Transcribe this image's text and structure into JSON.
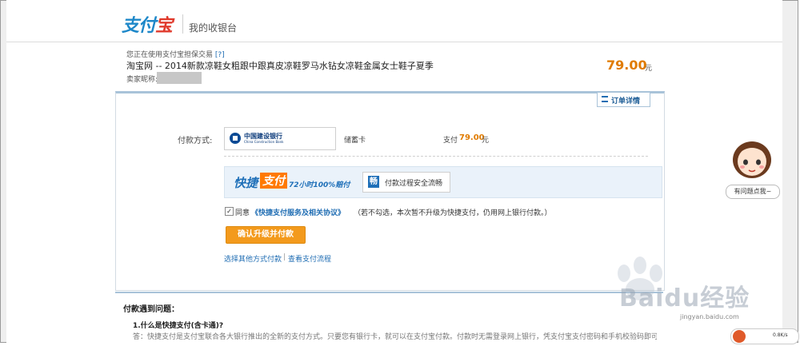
{
  "header": {
    "logo_text_blue": "支付",
    "logo_text_red": "宝",
    "cashier_title": "我的收银台"
  },
  "order": {
    "guarantee_text": "您正在使用支付宝担保交易",
    "guarantee_link": "[?]",
    "title": "淘宝网 -- 2014新款凉鞋女粗跟中跟真皮凉鞋罗马水钻女凉鞋金属女士鞋子夏季",
    "seller_label": "卖家昵称:",
    "price": "79.00",
    "price_unit": "元",
    "detail_button": "订单详情"
  },
  "payment": {
    "method_label": "付款方式:",
    "bank_name_cn": "中国建设银行",
    "bank_name_en": "China Construction Bank",
    "card_type": "储蓄卡",
    "pay_label": "支付",
    "pay_amount": "79.00",
    "pay_unit": "元"
  },
  "promo": {
    "fast": "快捷",
    "pay": "支付",
    "tagline": "72小时100%赔付",
    "safe_icon": "畅",
    "safe_text": "付款过程安全流畅"
  },
  "agreement": {
    "checked": true,
    "prefix": "同意",
    "link": "《快捷支付服务及相关协议》",
    "note": "（若不勾选，本次暂不升级为快捷支付，仍用网上银行付款。）"
  },
  "actions": {
    "confirm_button": "确认升级并付款",
    "other_methods": "选择其他方式付款",
    "separator": "|",
    "view_flow": "查看支付流程"
  },
  "faq": {
    "title": "付款遇到问题：",
    "q1": "1.什么是快捷支付(含卡通)?",
    "a1": "答：快捷支付是支付宝联合各大银行推出的全新的支付方式。只要您有银行卡，就可以在支付宝付款。付款时无需登录网上银行，凭支付宝支付密码和手机校验码即可完"
  },
  "help": {
    "bubble": "有问题点我~"
  },
  "speed": {
    "value": "0.8K/s"
  },
  "watermark": {
    "text": "Baidu经验",
    "url": "jingyan.baidu.com"
  },
  "colors": {
    "accent_orange": "#e07b00",
    "link_blue": "#1f6db3",
    "button_orange": "#f39a1c"
  }
}
